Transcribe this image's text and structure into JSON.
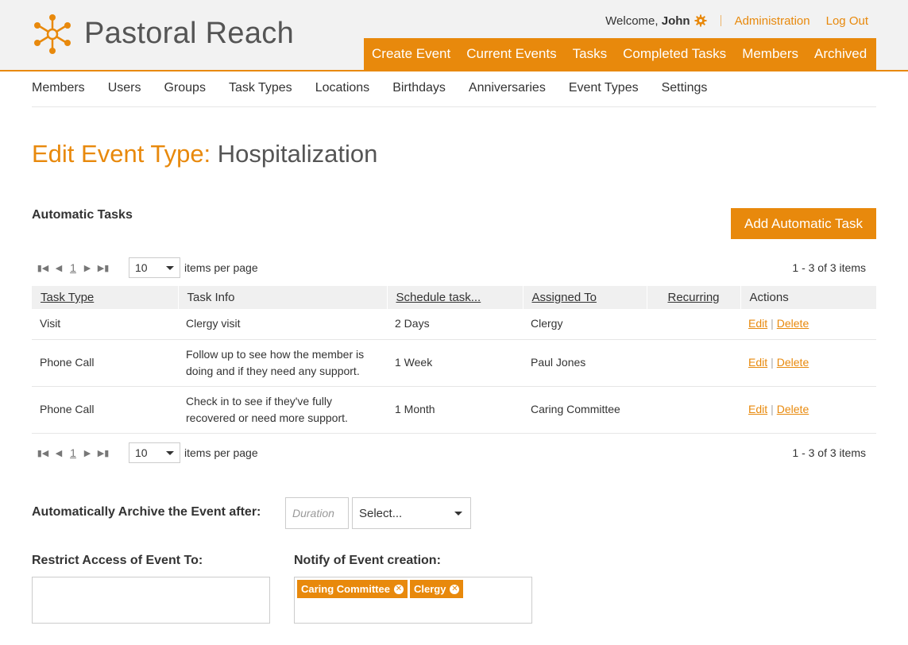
{
  "app": {
    "brand": "Pastoral Reach"
  },
  "header": {
    "welcome_prefix": "Welcome, ",
    "user_name": "John",
    "links": {
      "administration": "Administration",
      "logout": "Log Out"
    }
  },
  "main_nav": [
    "Create Event",
    "Current Events",
    "Tasks",
    "Completed Tasks",
    "Members",
    "Archived"
  ],
  "sub_nav": [
    "Members",
    "Users",
    "Groups",
    "Task Types",
    "Locations",
    "Birthdays",
    "Anniversaries",
    "Event Types",
    "Settings"
  ],
  "page": {
    "title_prefix": "Edit Event Type: ",
    "title_name": "Hospitalization"
  },
  "automatic_tasks": {
    "title": "Automatic Tasks",
    "add_button": "Add Automatic Task",
    "pager": {
      "current_page": "1",
      "page_size": "10",
      "items_per_page_label": "items per page",
      "info": "1 - 3 of 3 items"
    },
    "columns": [
      "Task Type",
      "Task Info",
      "Schedule task...",
      "Assigned To",
      "Recurring",
      "Actions"
    ],
    "rows": [
      {
        "task_type": "Visit",
        "task_info": "Clergy visit",
        "schedule": "2 Days",
        "assigned_to": "Clergy",
        "recurring": ""
      },
      {
        "task_type": "Phone Call",
        "task_info": "Follow up to see how the member is doing and if they need any support.",
        "schedule": "1 Week",
        "assigned_to": "Paul Jones",
        "recurring": ""
      },
      {
        "task_type": "Phone Call",
        "task_info": "Check in to see if they've fully recovered or need more support.",
        "schedule": "1 Month",
        "assigned_to": "Caring Committee",
        "recurring": ""
      }
    ],
    "actions": {
      "edit": "Edit",
      "delete": "Delete",
      "separator": "|"
    }
  },
  "archive": {
    "label": "Automatically Archive the Event after:",
    "duration_placeholder": "Duration",
    "unit_selected": "Select..."
  },
  "restrict_access": {
    "label": "Restrict Access of Event To:"
  },
  "notify": {
    "label": "Notify of Event creation:",
    "tags": [
      "Caring Committee",
      "Clergy"
    ]
  },
  "colors": {
    "accent": "#e8890c",
    "header_bg": "#f2f2f2",
    "table_header_bg": "#f0f0f0"
  }
}
